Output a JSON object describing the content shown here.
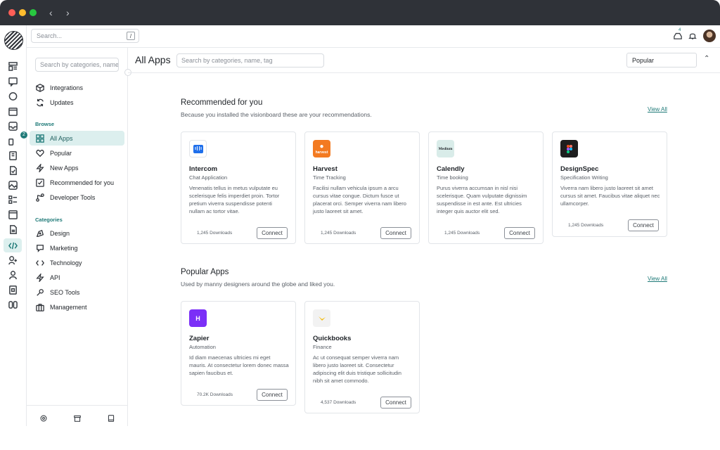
{
  "topbar": {
    "search_placeholder": "Search...",
    "shortcut": "/",
    "notif_count": "4"
  },
  "rail": {
    "chat_badge": "2"
  },
  "sidebar": {
    "search_placeholder": "Search by categories, name, tag",
    "top_items": [
      {
        "label": "Integrations"
      },
      {
        "label": "Updates"
      }
    ],
    "browse_heading": "Browse",
    "browse_items": [
      {
        "label": "All Apps"
      },
      {
        "label": "Popular"
      },
      {
        "label": "New Apps"
      },
      {
        "label": "Recommended for you"
      },
      {
        "label": "Developer Tools"
      }
    ],
    "categories_heading": "Categories",
    "category_items": [
      {
        "label": "Design"
      },
      {
        "label": "Marketing"
      },
      {
        "label": "Technology"
      },
      {
        "label": "API"
      },
      {
        "label": "SEO Tools"
      },
      {
        "label": "Management"
      }
    ]
  },
  "main": {
    "title": "All Apps",
    "search_placeholder": "Search by categories, name, tag",
    "sort_value": "Popular"
  },
  "recommended": {
    "title": "Recommended for you",
    "subtitle": "Because you installed the visionboard these are your recommendations.",
    "view_all": "View All",
    "apps": [
      {
        "name": "Intercom",
        "category": "Chat Application",
        "description": "Venenatis tellus in metus vulputate eu scelerisque felis imperdiet proin. Tortor pretium viverra suspendisse potenti nullam ac tortor vitae.",
        "downloads": "1,245 Downloads",
        "button": "Connect",
        "logo_color": "#ffffff"
      },
      {
        "name": "Harvest",
        "category": "Time Tracking",
        "description": "Facilisi nullam vehicula ipsum a arcu cursus vitae congue. Dictum fusce ut placerat orci. Semper viverra nam libero justo laoreet sit amet.",
        "downloads": "1,245 Downloads",
        "button": "Connect",
        "logo_color": "#f37a21",
        "logo_text": "harvest"
      },
      {
        "name": "Calendly",
        "category": "Time booking",
        "description": "Purus viverra accumsan in nisl nisi scelerisque. Quam vulputate dignissim suspendisse in est ante. Est ultricies integer quis auctor elit sed.",
        "downloads": "1,245 Downloads",
        "button": "Connect",
        "logo_color": "#d9ece9",
        "logo_text": "Medium"
      },
      {
        "name": "DesignSpec",
        "category": "Specification Writing",
        "description": "Viverra nam libero justo laoreet sit amet cursus sit amet. Faucibus vitae aliquet nec ullamcorper.",
        "downloads": "1,245 Downloads",
        "button": "Connect",
        "logo_color": "#1e1e1e"
      }
    ]
  },
  "popular": {
    "title": "Popular Apps",
    "subtitle": "Used by manny designers around the globe and liked you.",
    "view_all": "View All",
    "apps": [
      {
        "name": "Zapier",
        "category": "Automation",
        "description": "Id diam maecenas ultricies mi eget mauris. At consectetur lorem donec massa sapien faucibus et.",
        "downloads": "70.2K Downloads",
        "button": "Connect",
        "logo_color": "#7b2ff7",
        "logo_text": "H"
      },
      {
        "name": "Quickbooks",
        "category": "Finance",
        "description": "Ac ut consequat semper viverra nam libero justo laoreet sit. Consectetur adipiscing elit duis tristique sollicitudin nibh sit amet commodo.",
        "downloads": "4,537 Downloads",
        "button": "Connect",
        "logo_color": "#f2f2f2"
      }
    ]
  }
}
